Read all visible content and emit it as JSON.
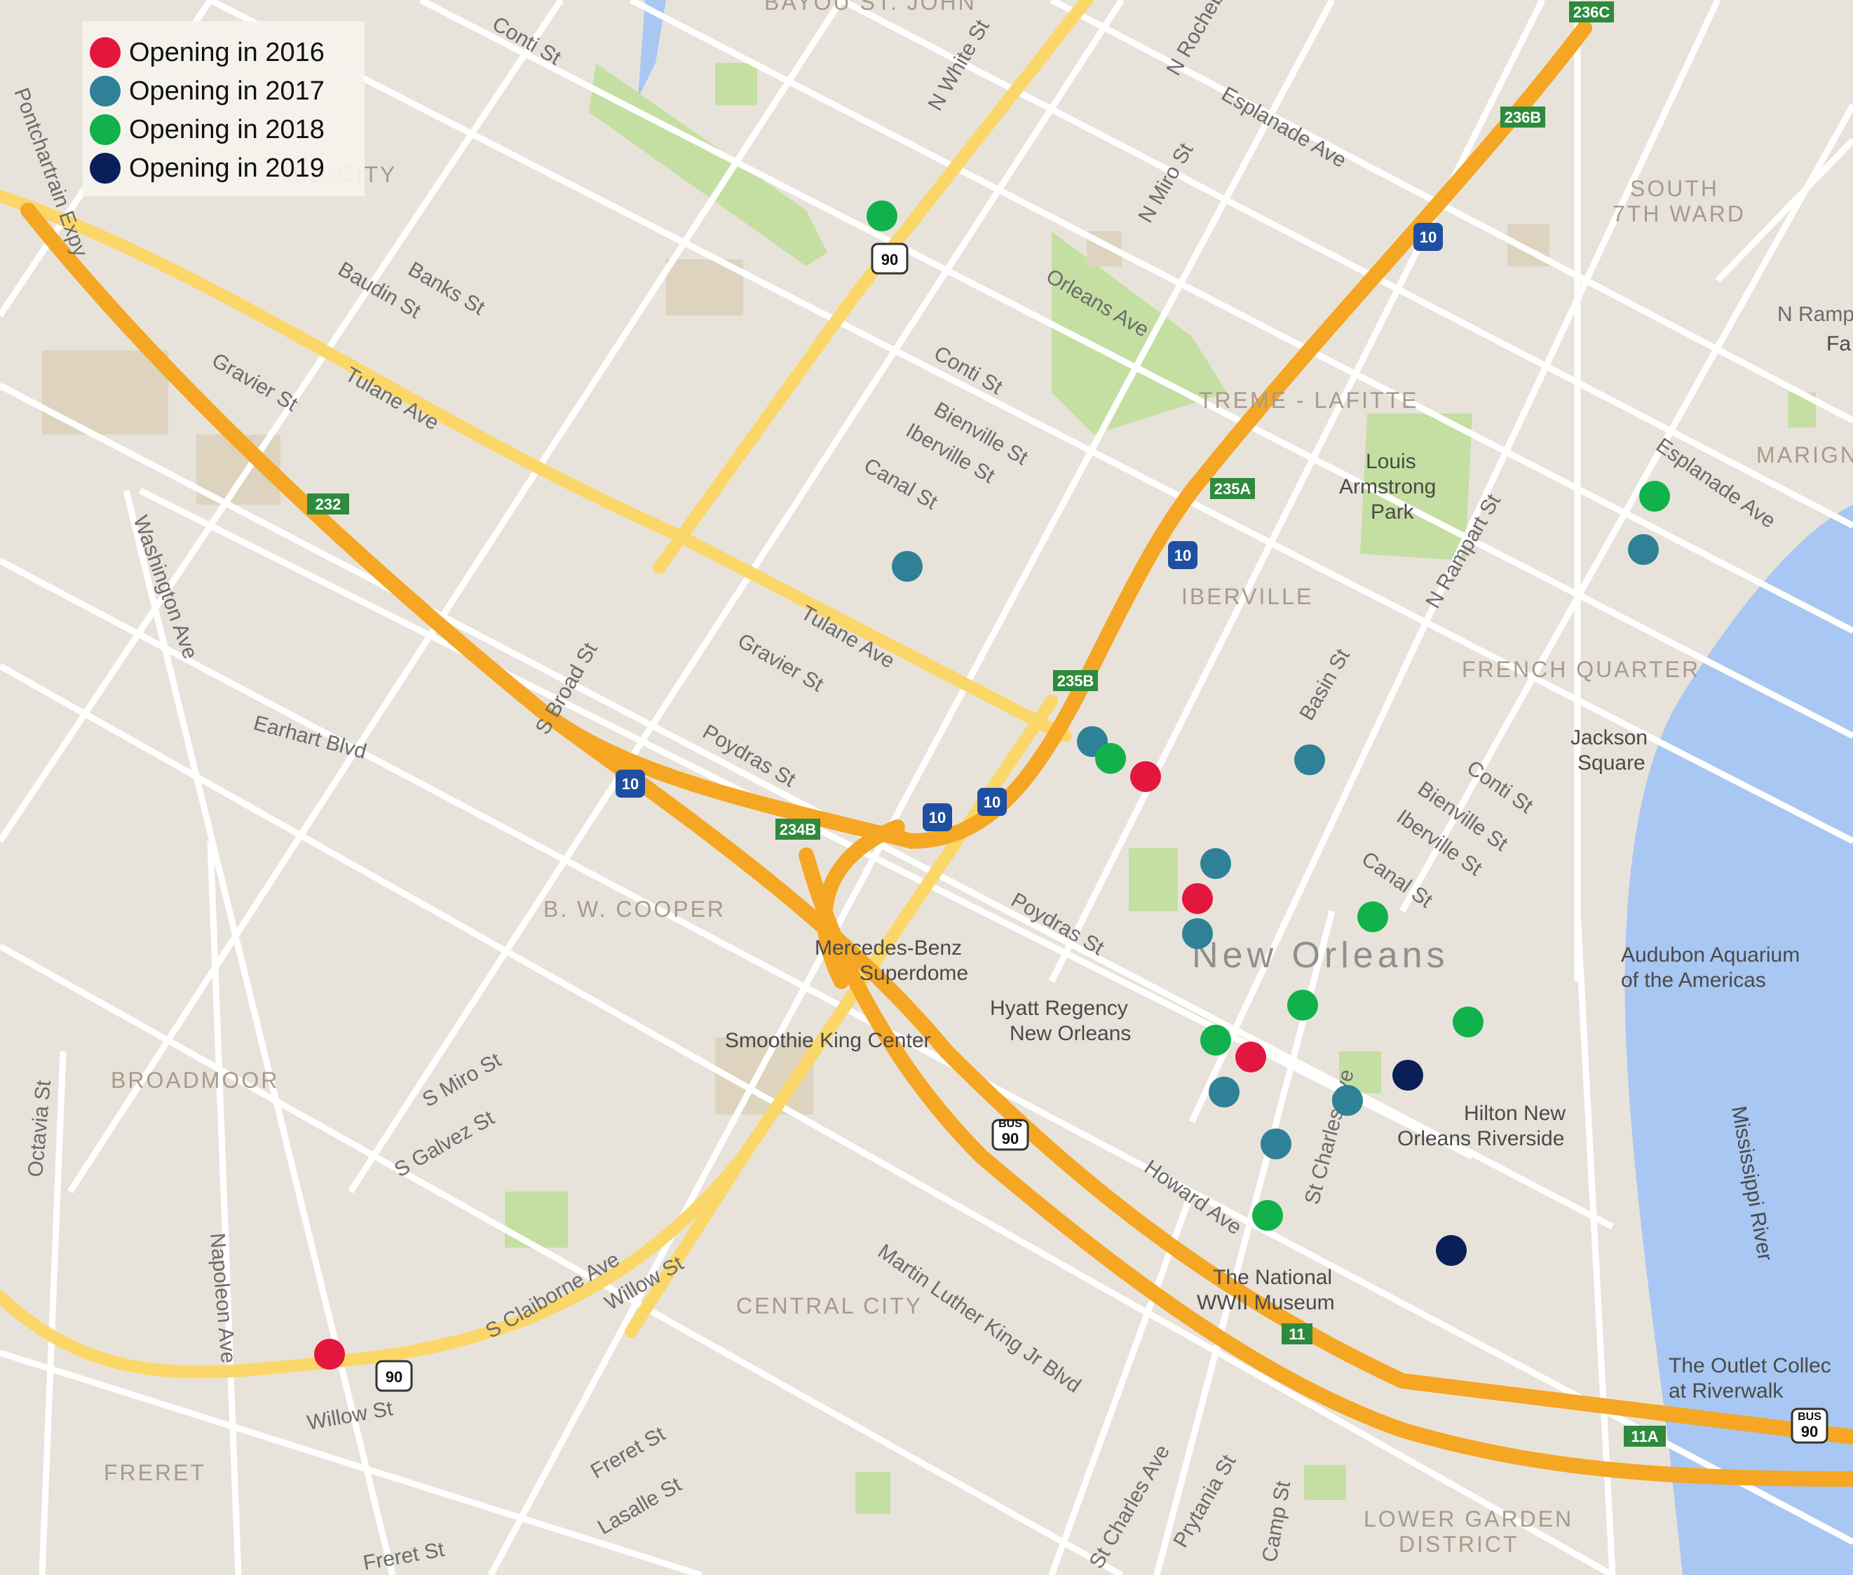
{
  "legend": {
    "items": [
      {
        "label": "Opening in 2016",
        "color": "#e3163d"
      },
      {
        "label": "Opening in 2017",
        "color": "#2e8196"
      },
      {
        "label": "Opening in 2018",
        "color": "#11b14b"
      },
      {
        "label": "Opening in 2019",
        "color": "#0a1f57"
      }
    ]
  },
  "map": {
    "colors": {
      "background": "#e8e3da",
      "park": "#c5dfa3",
      "water": "#a8c7f2",
      "highway": "#f5a623",
      "arterial": "#fbd76a",
      "street": "#ffffff"
    },
    "streets": [
      "Conti St",
      "N White St",
      "N Rocheblave",
      "Esplanade Ave",
      "N Miro St",
      "Orleans Ave",
      "Conti St",
      "Bienville St",
      "Iberville St",
      "Canal St",
      "Baudin St",
      "Banks St",
      "Gravier St",
      "Tulane Ave",
      "Tulane Ave",
      "Gravier St",
      "S Broad St",
      "Poydras St",
      "Washington Ave",
      "Earhart Blvd",
      "Poydras St",
      "Basin St",
      "N Rampart St",
      "Esplanade Ave",
      "Conti St",
      "Bienville St",
      "Iberville St",
      "Canal St",
      "S Miro St",
      "S Galvez St",
      "Octavia St",
      "Napoleon Ave",
      "S Claiborne Ave",
      "Willow St",
      "Willow St",
      "Martin Luther King Jr Blvd",
      "Freret St",
      "Lasalle St",
      "Freret St",
      "Howard Ave",
      "St Charles Ave",
      "St Charles Ave",
      "Prytania St",
      "Camp St",
      "N Rampa",
      "Pontchartrain Expy"
    ],
    "neighborhoods": [
      "BAYOU ST. JOHN",
      "MID-CITY",
      "SOUTH",
      "7TH WARD",
      "TREME - LAFITTE",
      "MARIGNY",
      "IBERVILLE",
      "FRENCH QUARTER",
      "B. W. COOPER",
      "BROADMOOR",
      "CENTRAL CITY",
      "FRERET",
      "LOWER GARDEN",
      "DISTRICT"
    ],
    "city_label": "New Orleans",
    "places": [
      "Louis",
      "Armstrong",
      "Park",
      "Jackson",
      "Square",
      "Audubon Aquarium",
      "of the Americas",
      "Mercedes-Benz",
      "Superdome",
      "Hyatt Regency",
      "New Orleans",
      "Smoothie King Center",
      "Hilton New",
      "Orleans Riverside",
      "The National",
      "WWII Museum",
      "The Outlet Collec",
      "at Riverwalk",
      "Fa",
      "Mississippi River"
    ],
    "shields": [
      "236C",
      "236B",
      "10",
      "235A",
      "10",
      "235B",
      "10",
      "10",
      "10",
      "234B",
      "232",
      "90",
      "90",
      "90",
      "11",
      "11A",
      "90"
    ],
    "shield_bus": "BUS",
    "markers": [
      {
        "year": 2018
      },
      {
        "year": 2017
      },
      {
        "year": 2018
      },
      {
        "year": 2017
      },
      {
        "year": 2017
      },
      {
        "year": 2018
      },
      {
        "year": 2016
      },
      {
        "year": 2017
      },
      {
        "year": 2017
      },
      {
        "year": 2016
      },
      {
        "year": 2017
      },
      {
        "year": 2018
      },
      {
        "year": 2018
      },
      {
        "year": 2018
      },
      {
        "year": 2018
      },
      {
        "year": 2016
      },
      {
        "year": 2019
      },
      {
        "year": 2017
      },
      {
        "year": 2017
      },
      {
        "year": 2017
      },
      {
        "year": 2018
      },
      {
        "year": 2019
      },
      {
        "year": 2016
      }
    ]
  }
}
